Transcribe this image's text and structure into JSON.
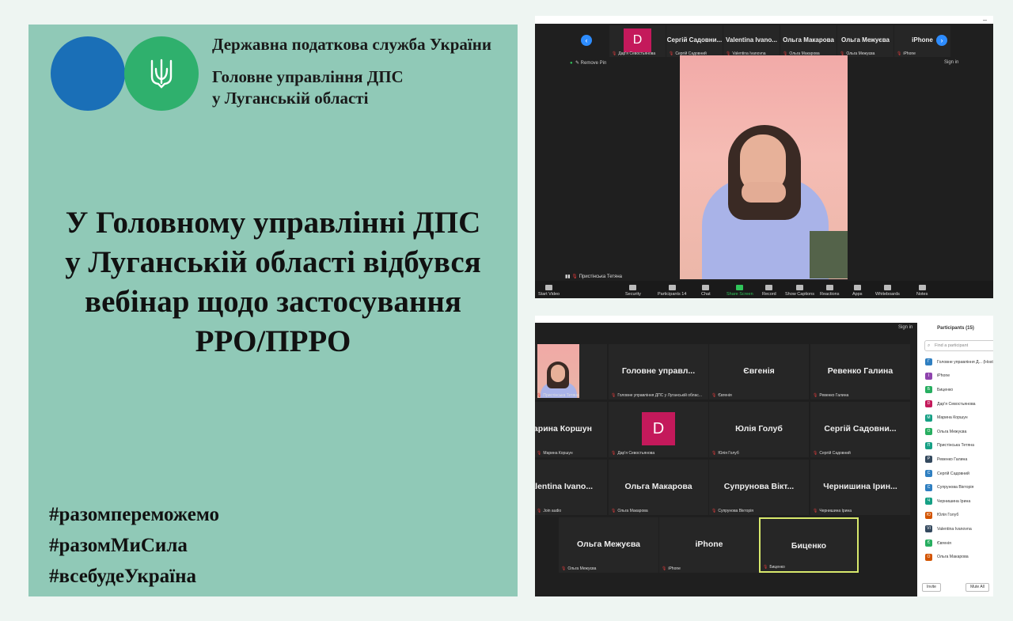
{
  "poster": {
    "org_line1": "Державна податкова служба України",
    "org_line2": "Головне управління ДПС",
    "org_line3": "у Луганській області",
    "headline_line1": "У Головному управлінні ДПС",
    "headline_line2": "у Луганській області відбувся",
    "headline_line3": "вебінар щодо застосування",
    "headline_line4": "РРО/ПРРО",
    "hashtag1": "#разомпереможемо",
    "hashtag2": "#разомМиСила",
    "hashtag3": "#всебудеУкраїна",
    "colors": {
      "background": "#90c9b7",
      "logo_blue": "#1a6fb7",
      "logo_green": "#2fb06d"
    }
  },
  "shot1": {
    "strip": [
      {
        "name": "D",
        "label": "Дар'я Севостьянова",
        "avatar": true
      },
      {
        "name": "Сергій Садовни...",
        "label": "Сергій Садовний"
      },
      {
        "name": "Valentina Ivano...",
        "label": "Valentina Ivanovna"
      },
      {
        "name": "Ольга Макарова",
        "label": "Ольга Макарова"
      },
      {
        "name": "Ольга Межуєва",
        "label": "Ольга Межуєва"
      },
      {
        "name": "iPhone",
        "label": "iPhone"
      }
    ],
    "remove_pin": "Remove Pin",
    "sign_in": "Sign in",
    "speaker": "Пристінська Тетяна",
    "toolbar": {
      "start_video": "Start Video",
      "security": "Security",
      "participants": "Participants",
      "participants_count": "14",
      "chat": "Chat",
      "share_screen": "Share Screen",
      "record": "Record",
      "show_captions": "Show Captions",
      "reactions": "Reactions",
      "apps": "Apps",
      "whiteboards": "Whiteboards",
      "notes": "Notes"
    }
  },
  "shot2": {
    "sign_in": "Sign in",
    "tiles": [
      {
        "name": "",
        "label": "Пристінська Тетяна",
        "video": true
      },
      {
        "name": "Головне управл...",
        "label": "Головне управління ДПС у Луганській облас..."
      },
      {
        "name": "Євгенія",
        "label": "Євгенія"
      },
      {
        "name": "Ревенко Галина",
        "label": "Ревенко Галина"
      },
      {
        "name": "Марина Коршун",
        "label": "Марина Коршун"
      },
      {
        "name": "D",
        "label": "Дар'я Севостьянова",
        "avatar": true
      },
      {
        "name": "Юлія Голуб",
        "label": "Юлія Голуб"
      },
      {
        "name": "Сергій Садовни...",
        "label": "Сергій Садовний"
      },
      {
        "name": "Valentina Ivano...",
        "label": "Join audio"
      },
      {
        "name": "Ольга Макарова",
        "label": "Ольга Макарова"
      },
      {
        "name": "Супрунова Вікт...",
        "label": "Супрунова Вікторія"
      },
      {
        "name": "Чернишина Ірин...",
        "label": "Чернишина Ірина"
      },
      {
        "name": "Ольга Межуєва",
        "label": "Ольга Межуєва"
      },
      {
        "name": "iPhone",
        "label": "iPhone"
      },
      {
        "name": "Биценко",
        "label": "Биценко",
        "active": true
      }
    ],
    "panel": {
      "title": "Participants (15)",
      "search_placeholder": "Find a participant",
      "participants": [
        {
          "initial": "Г",
          "name": "Головне управління Д... (Host, me)",
          "color": "#2f7fc1"
        },
        {
          "initial": "I",
          "name": "iPhone",
          "color": "#8e44ad"
        },
        {
          "initial": "Б",
          "name": "Биценко",
          "color": "#27ae60"
        },
        {
          "initial": "D",
          "name": "Дар'я Севостьянова",
          "color": "#c4195b"
        },
        {
          "initial": "М",
          "name": "Марина Коршун",
          "color": "#16a085"
        },
        {
          "initial": "О",
          "name": "Ольга Межуєва",
          "color": "#27ae60"
        },
        {
          "initial": "П",
          "name": "Пристінська Тетяна",
          "color": "#16a085"
        },
        {
          "initial": "Р",
          "name": "Ревенко Галина",
          "color": "#34495e"
        },
        {
          "initial": "С",
          "name": "Сергій Садовний",
          "color": "#2f7fc1"
        },
        {
          "initial": "С",
          "name": "Супрунова Вікторія",
          "color": "#2f7fc1"
        },
        {
          "initial": "Ч",
          "name": "Чернишина Ірина",
          "color": "#16a085"
        },
        {
          "initial": "Ю",
          "name": "Юлія Голуб",
          "color": "#d35400"
        },
        {
          "initial": "VI",
          "name": "Valentina Ivanovna",
          "color": "#34495e"
        },
        {
          "initial": "Є",
          "name": "Євгенія",
          "color": "#27ae60"
        },
        {
          "initial": "О",
          "name": "Ольга Макарова",
          "color": "#d35400"
        }
      ],
      "invite": "Invite",
      "mute_all": "Mute All"
    }
  }
}
